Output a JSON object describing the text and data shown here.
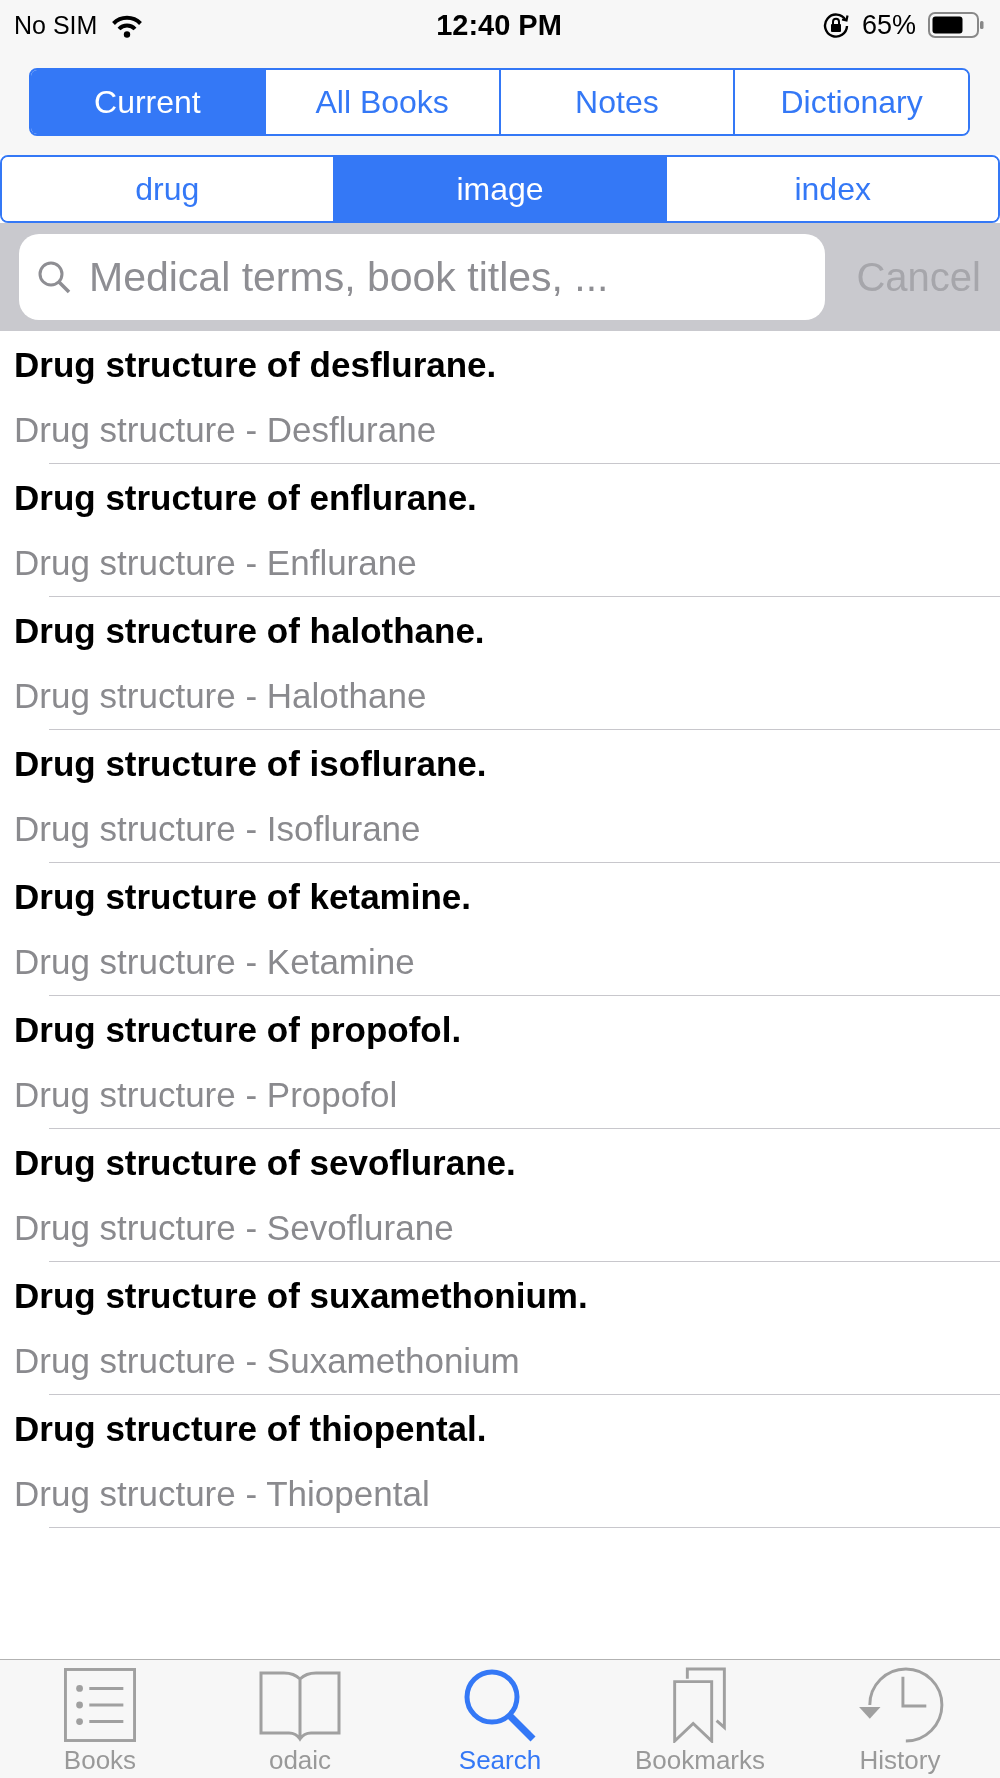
{
  "status_bar": {
    "carrier": "No SIM",
    "time": "12:40 PM",
    "battery": "65%"
  },
  "scope_tabs": [
    {
      "label": "Current",
      "selected": true
    },
    {
      "label": "All Books",
      "selected": false
    },
    {
      "label": "Notes",
      "selected": false
    },
    {
      "label": "Dictionary",
      "selected": false
    }
  ],
  "type_tabs": [
    {
      "label": "drug",
      "selected": false
    },
    {
      "label": "image",
      "selected": true
    },
    {
      "label": "index",
      "selected": false
    }
  ],
  "search": {
    "placeholder": "Medical terms, book titles, ...",
    "cancel": {
      "label": "Cancel",
      "disabled": true
    }
  },
  "results": [
    {
      "title": "Drug structure of desflurane.",
      "subtitle": "Drug structure - Desflurane"
    },
    {
      "title": "Drug structure of enflurane.",
      "subtitle": "Drug structure - Enflurane"
    },
    {
      "title": "Drug structure of halothane.",
      "subtitle": "Drug structure - Halothane"
    },
    {
      "title": "Drug structure of isoflurane.",
      "subtitle": "Drug structure - Isoflurane"
    },
    {
      "title": "Drug structure of ketamine.",
      "subtitle": "Drug structure - Ketamine"
    },
    {
      "title": "Drug structure of propofol.",
      "subtitle": "Drug structure - Propofol"
    },
    {
      "title": "Drug structure of sevoflurane.",
      "subtitle": "Drug structure - Sevoflurane"
    },
    {
      "title": "Drug structure of suxamethonium.",
      "subtitle": "Drug structure - Suxamethonium"
    },
    {
      "title": "Drug structure of thiopental.",
      "subtitle": "Drug structure - Thiopental"
    }
  ],
  "tab_bar": [
    {
      "label": "Books",
      "kind": "list",
      "selected": false
    },
    {
      "label": "odaic",
      "kind": "book",
      "selected": false
    },
    {
      "label": "Search",
      "kind": "search",
      "selected": true
    },
    {
      "label": "Bookmarks",
      "kind": "bookmarks",
      "selected": false
    },
    {
      "label": "History",
      "kind": "history",
      "selected": false
    }
  ]
}
